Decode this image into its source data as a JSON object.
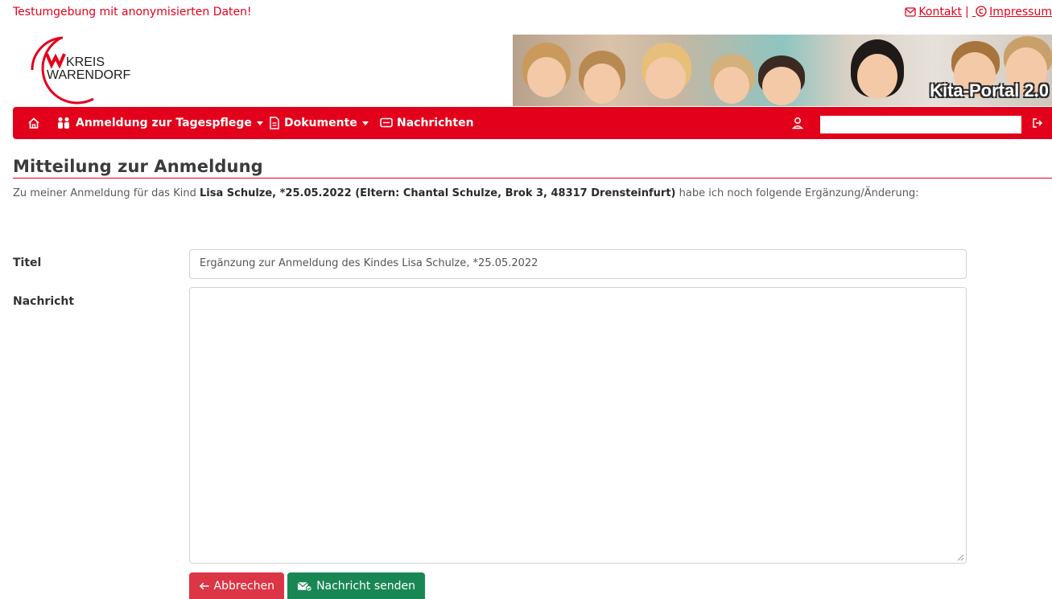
{
  "topbar": {
    "test_notice": "Testumgebung mit anonymisierten Daten!",
    "kontakt": "Kontakt",
    "separator": "|",
    "impressum": "Impressum"
  },
  "logo": {
    "line1": "KREIS",
    "line2": "WARENDORF"
  },
  "banner": {
    "title": "Kita-Portal 2.0"
  },
  "nav": {
    "anmeldung": "Anmeldung zur Tagespflege",
    "dokumente": "Dokumente",
    "nachrichten": "Nachrichten",
    "user_value": ""
  },
  "page": {
    "title": "Mitteilung zur Anmeldung",
    "intro_prefix": "Zu meiner Anmeldung für das Kind ",
    "intro_bold": "Lisa Schulze, *25.05.2022 (Eltern: Chantal Schulze, Brok 3, 48317 Drensteinfurt)",
    "intro_suffix": " habe ich noch folgende Ergänzung/Änderung:"
  },
  "form": {
    "titel_label": "Titel",
    "titel_value": "Ergänzung zur Anmeldung des Kindes Lisa Schulze, *25.05.2022",
    "nachricht_label": "Nachricht",
    "nachricht_value": ""
  },
  "buttons": {
    "cancel": "Abbrechen",
    "send": "Nachricht senden"
  },
  "colors": {
    "brand_red": "#e3001b",
    "cancel_red": "#dc3545",
    "send_green": "#198754"
  },
  "icons": [
    "home-icon",
    "users-icon",
    "document-icon",
    "message-icon",
    "user-icon",
    "logout-icon",
    "mail-icon",
    "copyright-icon",
    "arrow-left-icon",
    "send-mail-icon"
  ]
}
